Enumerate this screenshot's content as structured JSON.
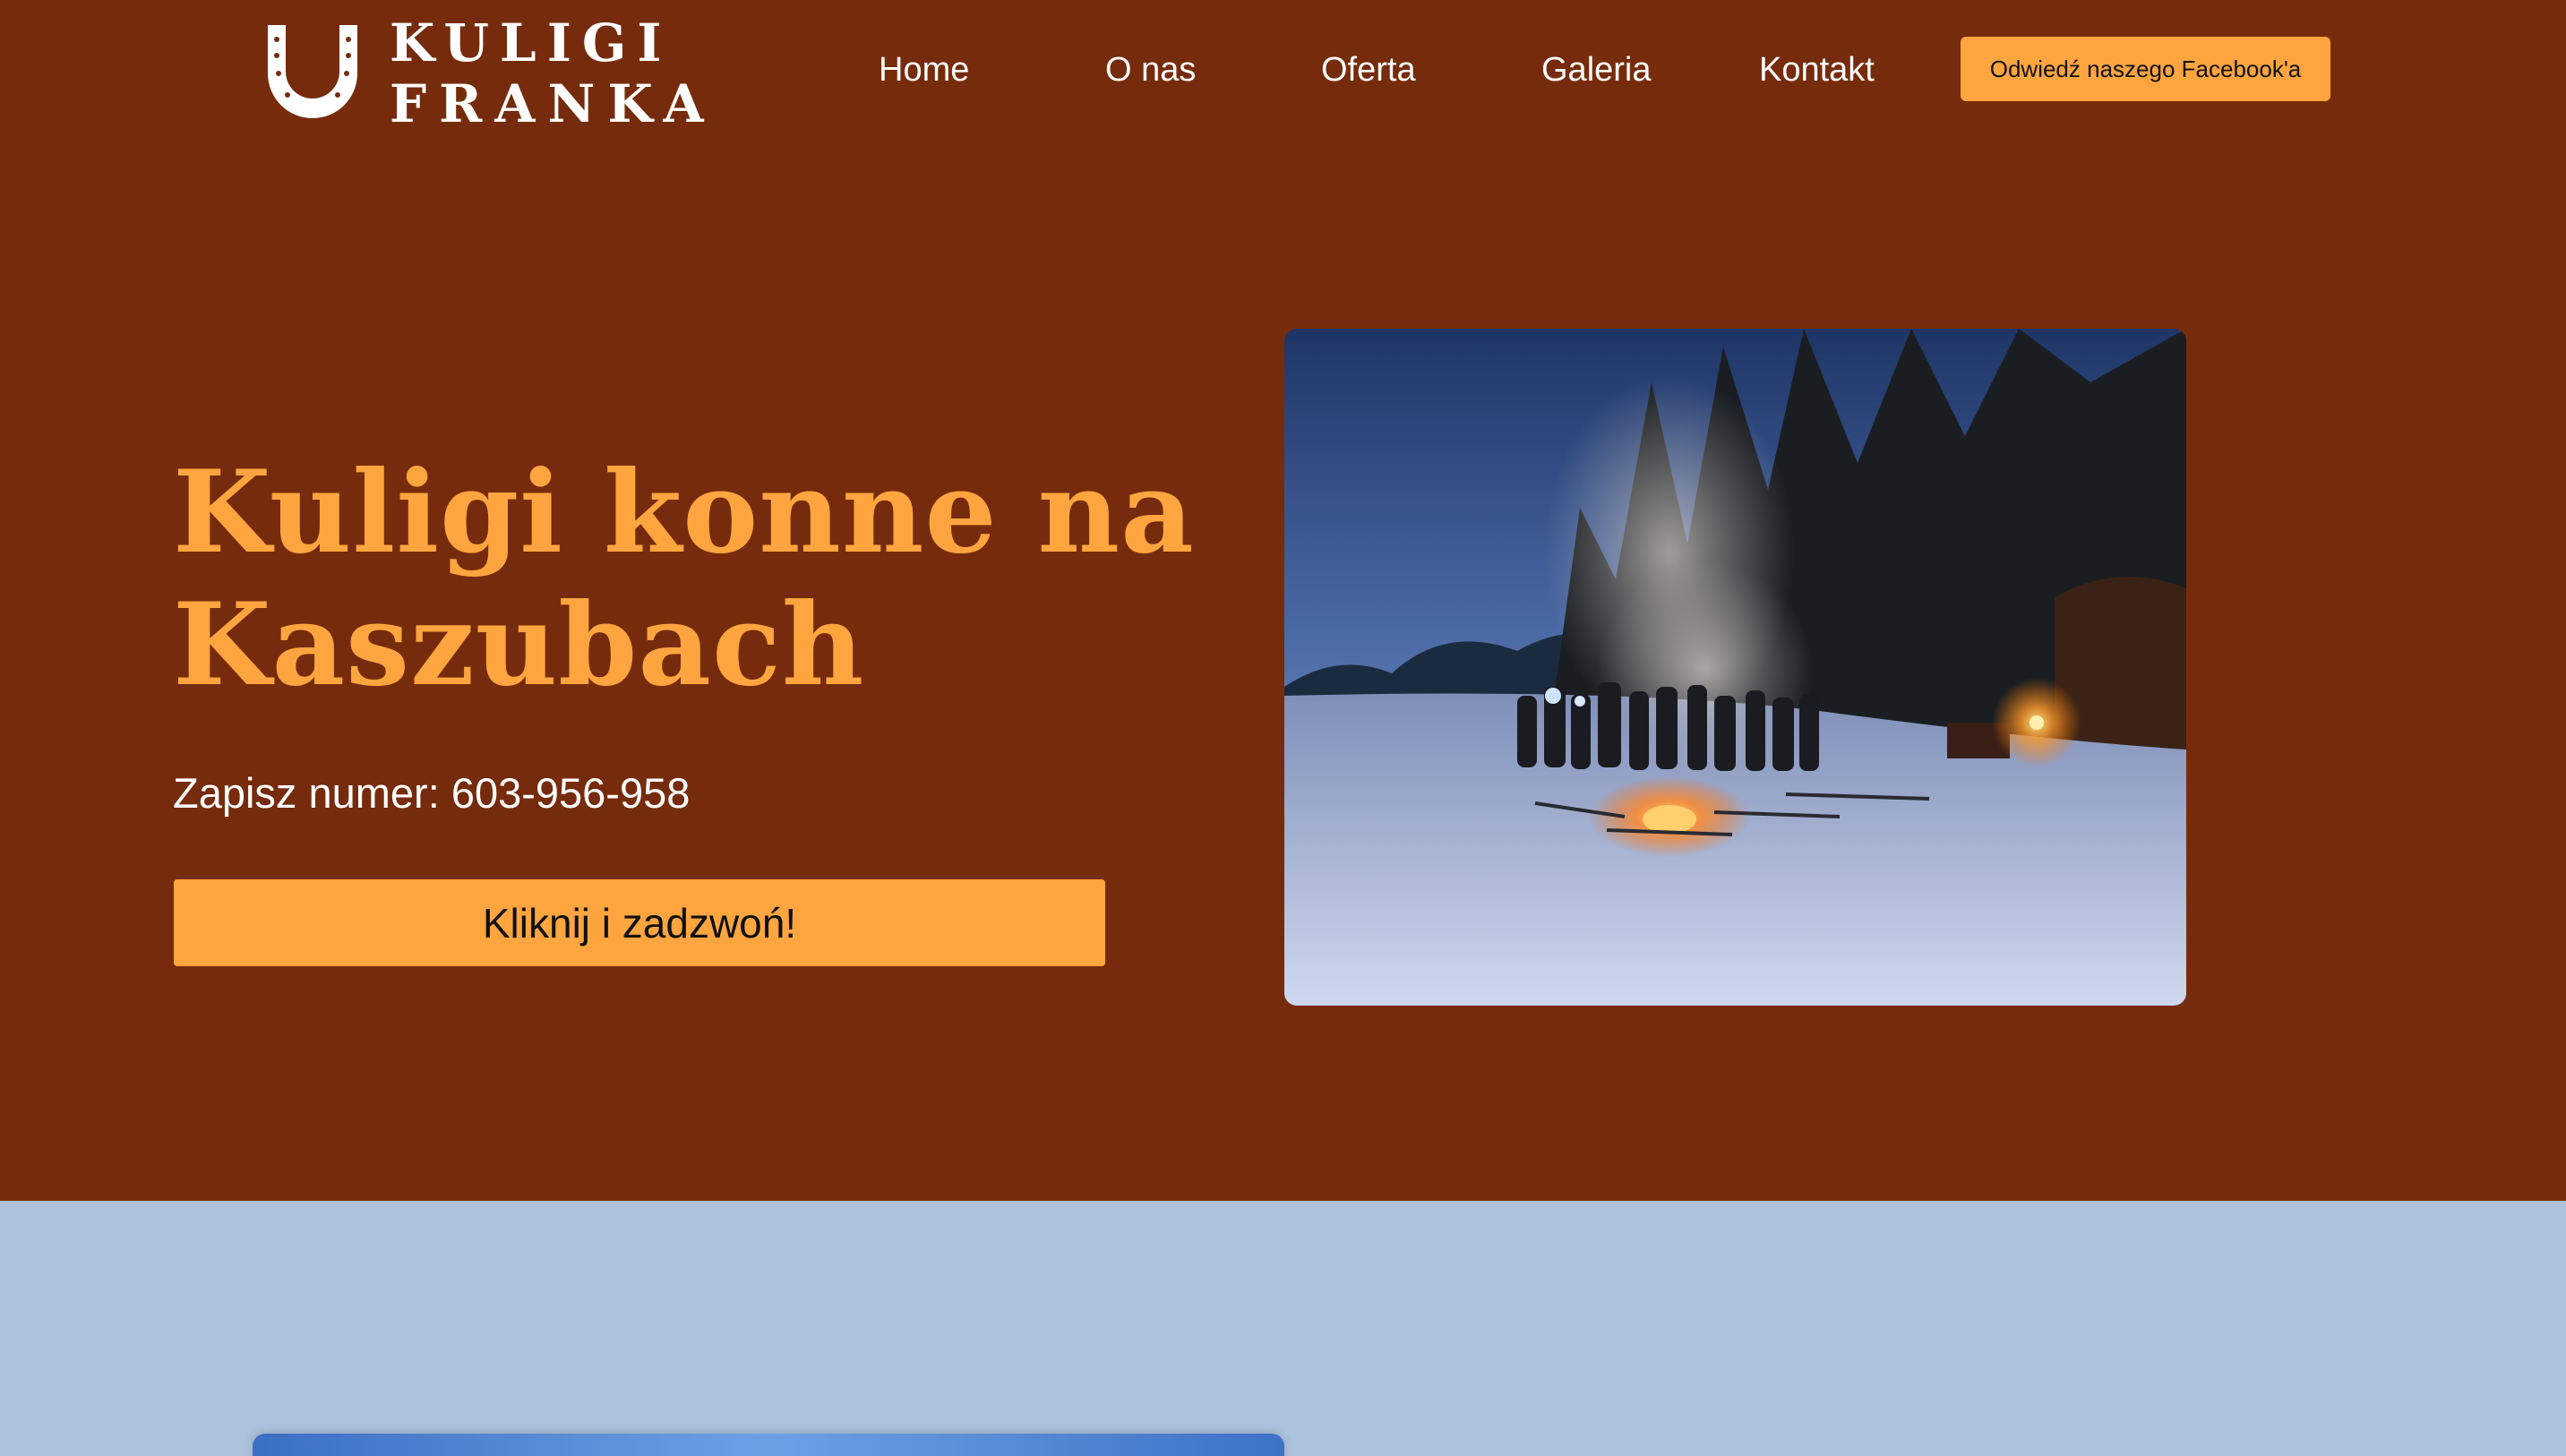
{
  "header": {
    "logo": {
      "line1": "KULIGI",
      "line2": "FRANKA",
      "icon": "horseshoe-icon"
    },
    "nav": [
      {
        "label": "Home"
      },
      {
        "label": "O nas"
      },
      {
        "label": "Oferta"
      },
      {
        "label": "Galeria"
      },
      {
        "label": "Kontakt"
      }
    ],
    "facebook_button": "Odwiedź naszego Facebook'a"
  },
  "hero": {
    "title_line1": "Kuligi konne na",
    "title_line2": "Kaszubach",
    "phone_text": "Zapisz numer: 603-956-958",
    "call_button": "Kliknij i zadzwoń!"
  },
  "colors": {
    "hero_background": "#762c0c",
    "accent": "#ffa53f",
    "second_section_background": "#adc2dc",
    "text_light": "#ffffff"
  }
}
